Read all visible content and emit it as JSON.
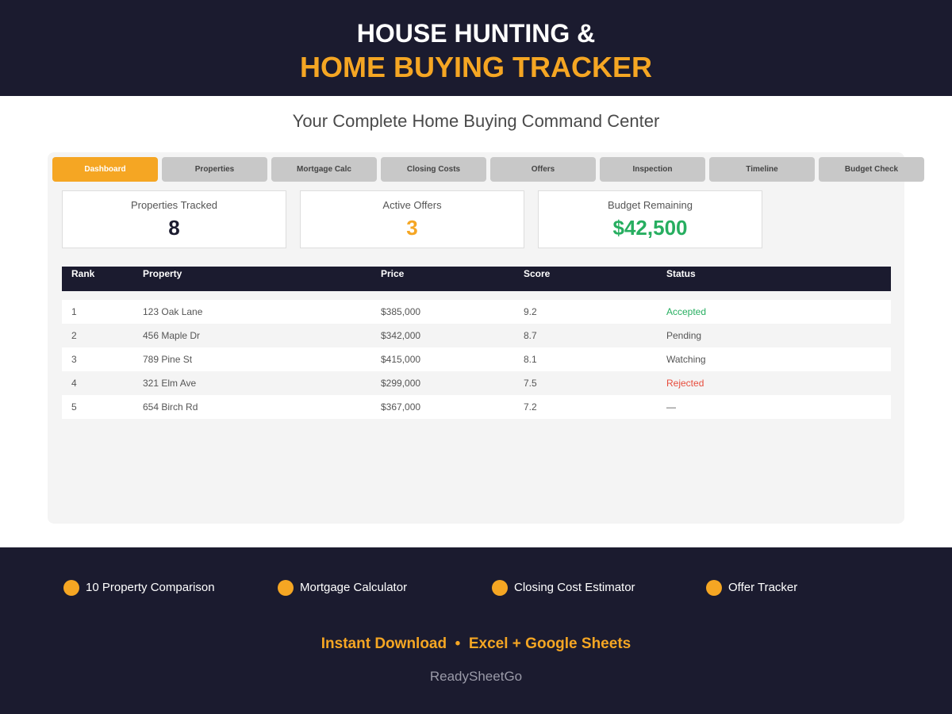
{
  "header": {
    "title_line1": "HOUSE HUNTING &",
    "title_line2": "HOME BUYING TRACKER",
    "subtitle": "Your Complete Home Buying Command Center"
  },
  "tabs": [
    "Dashboard",
    "Properties",
    "Mortgage Calc",
    "Closing Costs",
    "Offers",
    "Inspection",
    "Timeline",
    "Budget Check"
  ],
  "active_tab": "Dashboard",
  "stats": [
    {
      "label": "Properties Tracked",
      "value": "8",
      "color": "#1b1b2f"
    },
    {
      "label": "Active Offers",
      "value": "3",
      "color": "#f5a623"
    },
    {
      "label": "Budget Remaining",
      "value": "$42,500",
      "color": "#27ae60"
    }
  ],
  "table": {
    "headers": [
      "Rank",
      "Property",
      "Price",
      "Score",
      "Status"
    ],
    "rows": [
      [
        "1",
        "123 Oak Lane",
        "$385,000",
        "9.2",
        "Accepted"
      ],
      [
        "2",
        "456 Maple Dr",
        "$342,000",
        "8.7",
        "Pending"
      ],
      [
        "3",
        "789 Pine St",
        "$415,000",
        "8.1",
        "Watching"
      ],
      [
        "4",
        "321 Elm Ave",
        "$299,000",
        "7.5",
        "Rejected"
      ],
      [
        "5",
        "654 Birch Rd",
        "$367,000",
        "7.2",
        "—"
      ]
    ],
    "status_colors": {
      "Accepted": "#27ae60",
      "Rejected": "#e74c3c"
    }
  },
  "footer": {
    "features": [
      "10 Property Comparison",
      "Mortgage Calculator",
      "Closing Cost Estimator",
      "Offer Tracker"
    ],
    "cta": "Instant Download  •  Excel + Google Sheets",
    "brand": "ReadySheetGo"
  },
  "colors": {
    "navy": "#1b1b2f",
    "accent": "#f5a623"
  }
}
